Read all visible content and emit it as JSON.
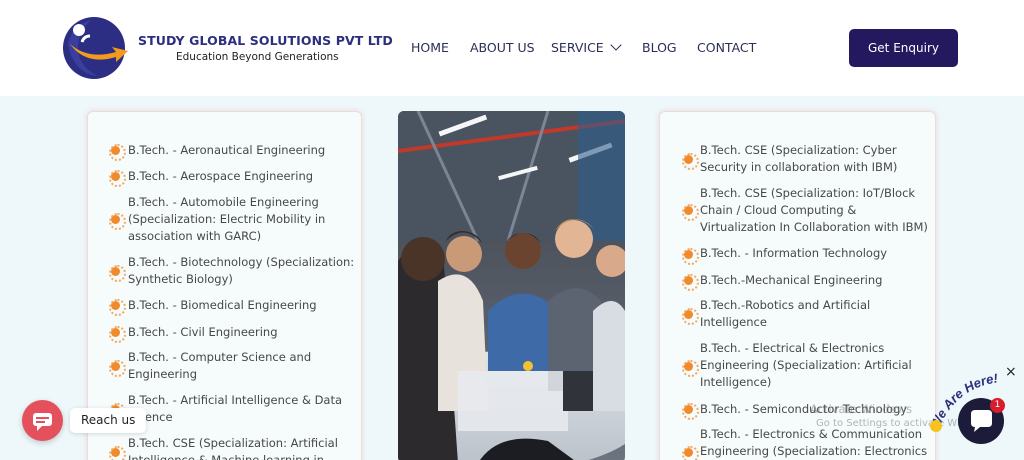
{
  "brand": {
    "name": "STUDY GLOBAL SOLUTIONS PVT LTD",
    "tagline": "Education Beyond Generations"
  },
  "nav": {
    "items": [
      "HOME",
      "ABOUT US",
      "SERVICE",
      "BLOG",
      "CONTACT"
    ],
    "service_icon": "chevron-down-icon"
  },
  "cta": {
    "label": "Get Enquiry"
  },
  "left_courses": [
    "B.Tech. - Aeronautical Engineering",
    "B.Tech. - Aerospace Engineering",
    "B.Tech. - Automobile Engineering (Specialization: Electric Mobility in association with GARC)",
    "B.Tech. - Biotechnology (Specialization: Synthetic Biology)",
    "B.Tech. - Biomedical Engineering",
    "B.Tech. - Civil Engineering",
    "B.Tech. - Computer Science and Engineering",
    "B.Tech. - Artificial Intelligence & Data Science",
    "B.Tech. CSE (Specialization: Artificial Intelligence & Machine learning in"
  ],
  "right_courses": [
    "B.Tech. CSE (Specialization: Cyber Security in collaboration with IBM)",
    "B.Tech. CSE (Specialization: IoT/Block Chain / Cloud Computing & Virtualization In Collaboration with IBM)",
    "B.Tech. - Information Technology",
    "B.Tech.-Mechanical Engineering",
    "B.Tech.-Robotics and Artificial Intelligence",
    "B.Tech. - Electrical & Electronics Engineering (Specialization: Artificial Intelligence)",
    "B.Tech. - Semiconductor Technology",
    "B.Tech. - Electronics & Communication Engineering (Specialization: Electronics"
  ],
  "widgets": {
    "reach_us": "Reach us",
    "chat_badge": "1",
    "chat_close": "×",
    "we_are_here": "We Are Here!",
    "watermark_line1": "Activate Windows",
    "watermark_line2": "Go to Settings to activate Windows."
  },
  "colors": {
    "brand": "#2b2f7e",
    "cta": "#24185e",
    "bullet": "#f08a2a",
    "reach": "#e4515c"
  }
}
